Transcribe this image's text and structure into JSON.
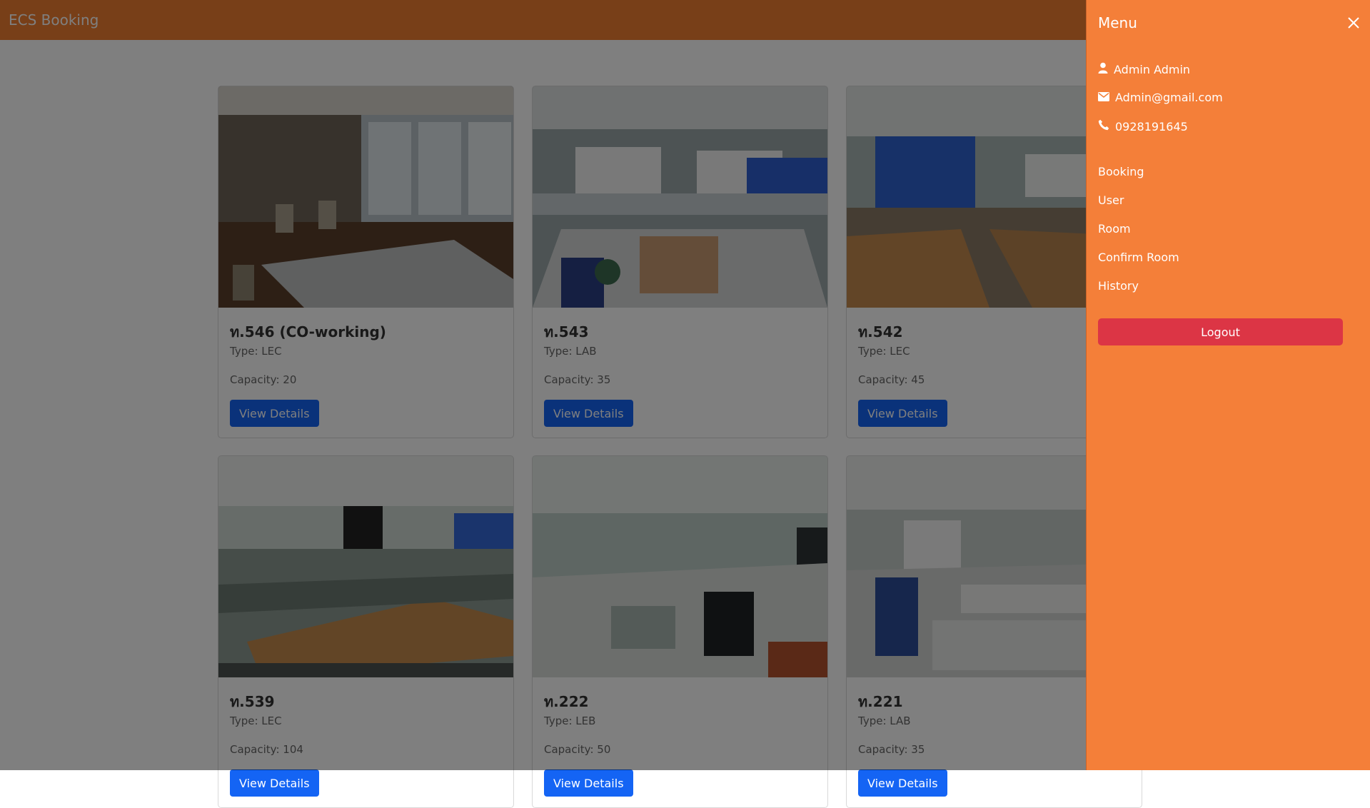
{
  "navbar": {
    "brand": "ECS Booking"
  },
  "rooms": [
    {
      "title": "ท.546 (CO-working)",
      "type": "Type: LEC",
      "capacity": "Capacity: 20",
      "button": "View Details"
    },
    {
      "title": "ท.543",
      "type": "Type: LAB",
      "capacity": "Capacity: 35",
      "button": "View Details"
    },
    {
      "title": "ท.542",
      "type": "Type: LEC",
      "capacity": "Capacity: 45",
      "button": "View Details"
    },
    {
      "title": "ท.539",
      "type": "Type: LEC",
      "capacity": "Capacity: 104",
      "button": "View Details"
    },
    {
      "title": "ท.222",
      "type": "Type: LEB",
      "capacity": "Capacity: 50",
      "button": "View Details"
    },
    {
      "title": "ท.221",
      "type": "Type: LAB",
      "capacity": "Capacity: 35",
      "button": "View Details"
    }
  ],
  "menu": {
    "title": "Menu",
    "user_name": "Admin Admin",
    "email": "Admin@gmail.com",
    "phone": "0928191645",
    "links": [
      "Booking",
      "User",
      "Room",
      "Confirm Room",
      "History"
    ],
    "logout": "Logout"
  },
  "colors": {
    "navbar": "#f07e30",
    "menu_bg": "#f47f39",
    "primary": "#1464f4",
    "danger": "#dc3545"
  }
}
